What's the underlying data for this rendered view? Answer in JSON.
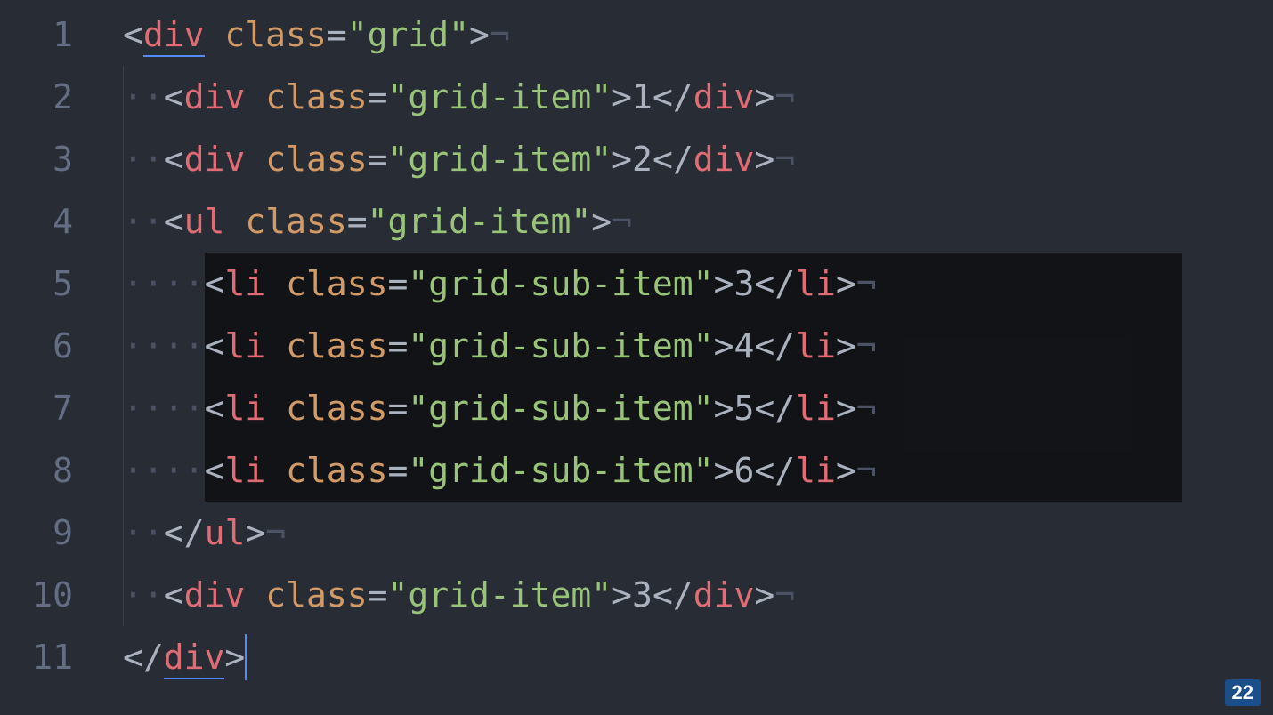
{
  "colors": {
    "background": "#282c34",
    "gutter": "#636d83",
    "punct": "#abb2bf",
    "tag": "#e06c75",
    "attr": "#d19a66",
    "string": "#98c379",
    "invisible": "#4b5263",
    "cursor": "#528bff",
    "selection": "rgba(0,0,0,0.55)"
  },
  "gutter": [
    "1",
    "2",
    "3",
    "4",
    "5",
    "6",
    "7",
    "8",
    "9",
    "10",
    "11"
  ],
  "invisibles": {
    "eol": "¬",
    "space": "·"
  },
  "tokens": {
    "lt": "<",
    "gt": ">",
    "slash": "/",
    "eq": "=",
    "div": "div",
    "ul": "ul",
    "li": "li",
    "class": "class",
    "grid": "\"grid\"",
    "grid_item": "\"grid-item\"",
    "grid_sub_item": "\"grid-sub-item\"",
    "space": " "
  },
  "content": {
    "item1": "1",
    "item2": "2",
    "sub3": "3",
    "sub4": "4",
    "sub5": "5",
    "sub6": "6",
    "item3": "3"
  },
  "badge": "22"
}
